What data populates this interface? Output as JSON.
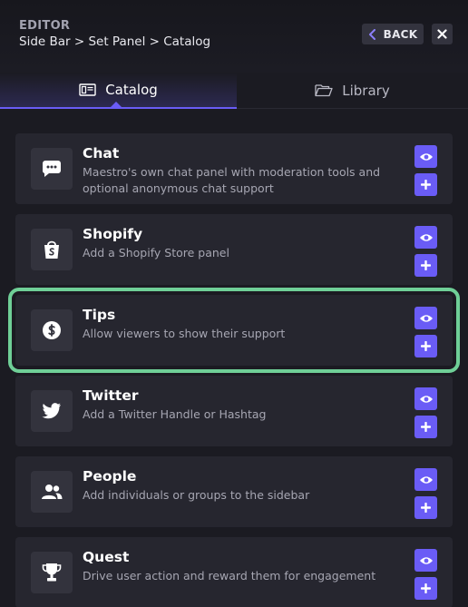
{
  "header": {
    "kicker": "EDITOR",
    "breadcrumb": "Side Bar > Set Panel > Catalog",
    "back_label": "BACK",
    "close_icon": "close-icon"
  },
  "tabs": [
    {
      "label": "Catalog",
      "icon": "catalog-icon",
      "active": true
    },
    {
      "label": "Library",
      "icon": "folder-icon",
      "active": false
    }
  ],
  "panels": [
    {
      "title": "Chat",
      "description": "Maestro's own chat panel with moderation tools and optional anonymous chat support",
      "icon": "chat-icon"
    },
    {
      "title": "Shopify",
      "description": "Add a Shopify Store panel",
      "icon": "shopify-icon"
    },
    {
      "title": "Tips",
      "description": "Allow viewers to show their support",
      "icon": "dollar-icon",
      "highlighted": true
    },
    {
      "title": "Twitter",
      "description": "Add a Twitter Handle or Hashtag",
      "icon": "twitter-icon"
    },
    {
      "title": "People",
      "description": "Add individuals or groups to the sidebar",
      "icon": "people-icon"
    },
    {
      "title": "Quest",
      "description": "Drive user action and reward them for engagement",
      "icon": "trophy-icon"
    }
  ],
  "colors": {
    "accent": "#6a5cf6",
    "highlight": "#6fcf97",
    "background": "#1b1b22",
    "card": "#26262f"
  }
}
